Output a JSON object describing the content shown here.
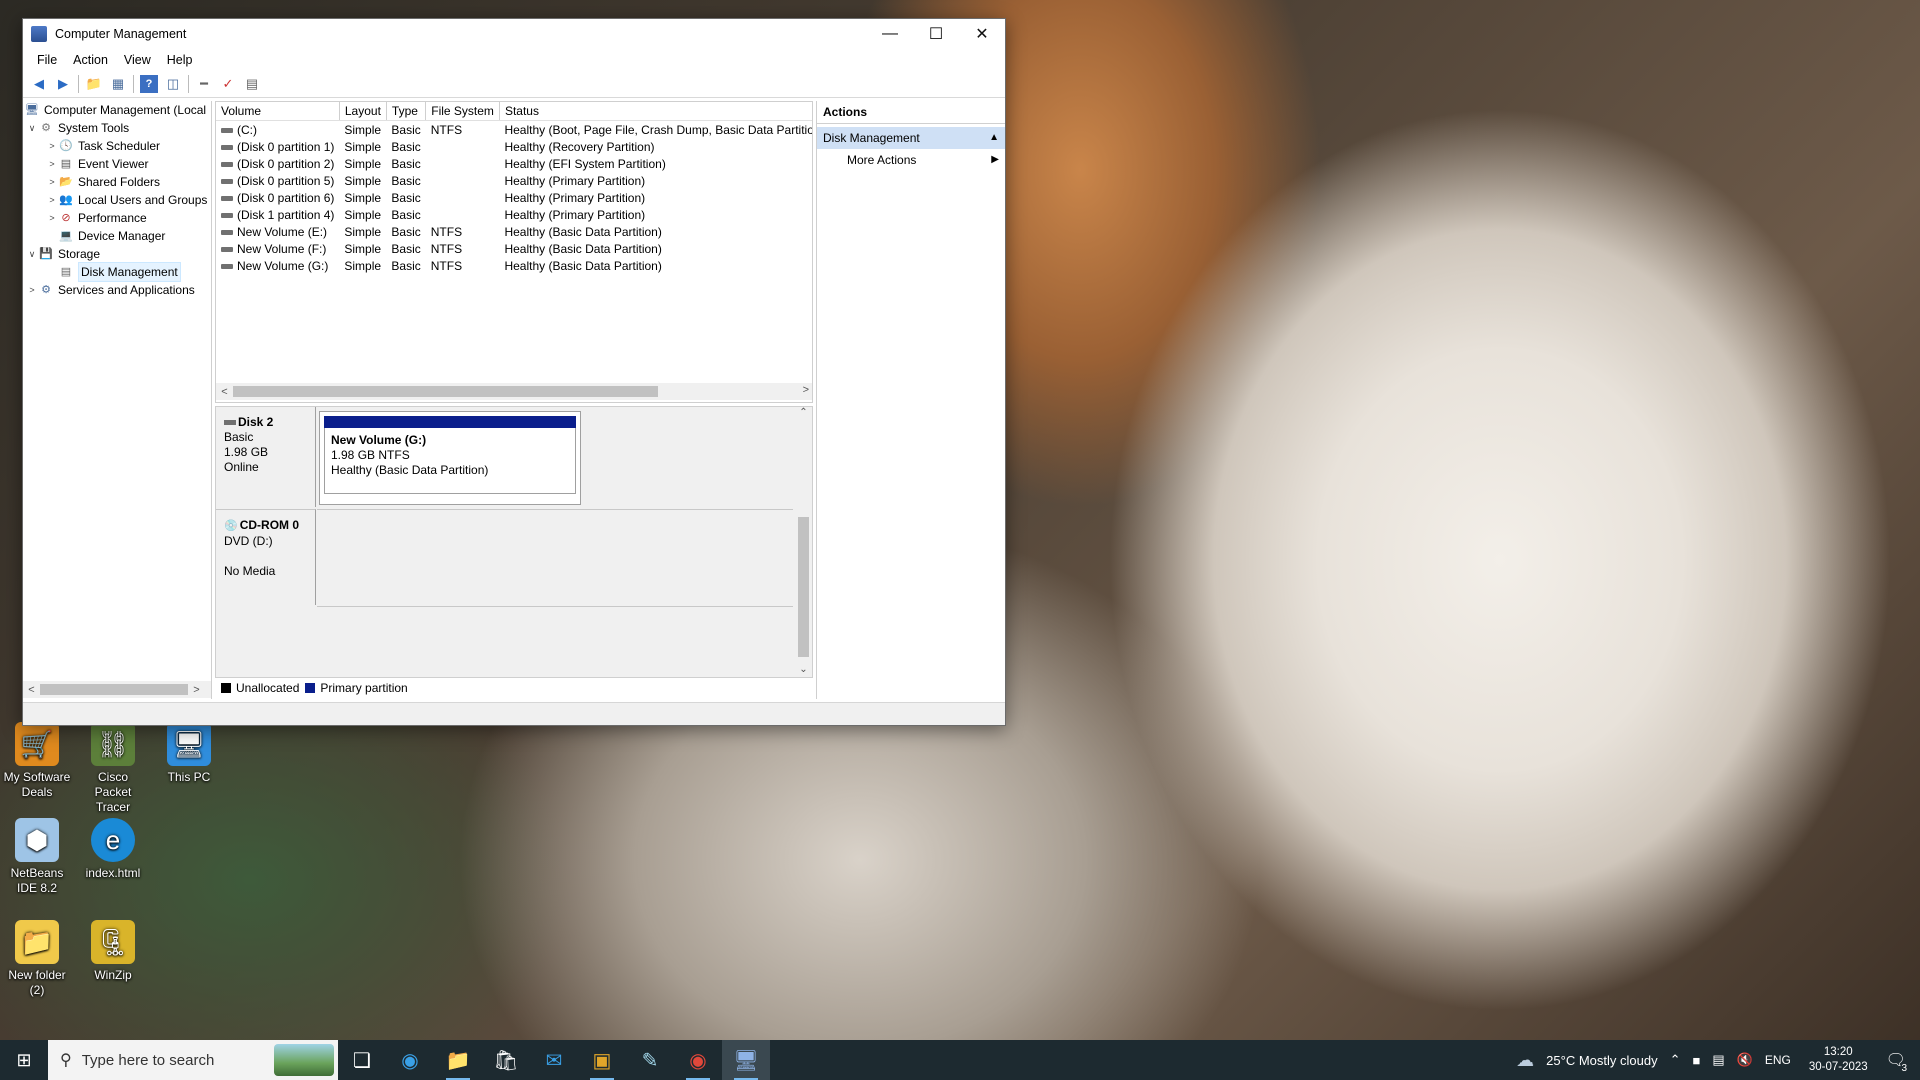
{
  "desktop": {
    "icons": [
      {
        "label": "My Software Deals",
        "icon": "shopping-cart-icon"
      },
      {
        "label": "Cisco Packet Tracer",
        "icon": "network-icon"
      },
      {
        "label": "This PC",
        "icon": "computer-icon"
      },
      {
        "label": "NetBeans IDE 8.2",
        "icon": "netbeans-icon"
      },
      {
        "label": "index.html",
        "icon": "edge-icon"
      },
      {
        "label": "New folder (2)",
        "icon": "folder-icon"
      },
      {
        "label": "WinZip",
        "icon": "winzip-icon"
      }
    ]
  },
  "window": {
    "title": "Computer Management",
    "menu": [
      "File",
      "Action",
      "View",
      "Help"
    ],
    "tree": {
      "root": "Computer Management (Local",
      "items": [
        {
          "label": "System Tools"
        },
        {
          "label": "Task Scheduler"
        },
        {
          "label": "Event Viewer"
        },
        {
          "label": "Shared Folders"
        },
        {
          "label": "Local Users and Groups"
        },
        {
          "label": "Performance"
        },
        {
          "label": "Device Manager"
        },
        {
          "label": "Storage"
        },
        {
          "label": "Disk Management"
        },
        {
          "label": "Services and Applications"
        }
      ]
    },
    "volume_table": {
      "headers": [
        "Volume",
        "Layout",
        "Type",
        "File System",
        "Status"
      ],
      "rows": [
        {
          "volume": "(C:)",
          "layout": "Simple",
          "type": "Basic",
          "fs": "NTFS",
          "status": "Healthy (Boot, Page File, Crash Dump, Basic Data Partition)"
        },
        {
          "volume": "(Disk 0 partition 1)",
          "layout": "Simple",
          "type": "Basic",
          "fs": "",
          "status": "Healthy (Recovery Partition)"
        },
        {
          "volume": "(Disk 0 partition 2)",
          "layout": "Simple",
          "type": "Basic",
          "fs": "",
          "status": "Healthy (EFI System Partition)"
        },
        {
          "volume": "(Disk 0 partition 5)",
          "layout": "Simple",
          "type": "Basic",
          "fs": "",
          "status": "Healthy (Primary Partition)"
        },
        {
          "volume": "(Disk 0 partition 6)",
          "layout": "Simple",
          "type": "Basic",
          "fs": "",
          "status": "Healthy (Primary Partition)"
        },
        {
          "volume": "(Disk 1 partition 4)",
          "layout": "Simple",
          "type": "Basic",
          "fs": "",
          "status": "Healthy (Primary Partition)"
        },
        {
          "volume": "New Volume (E:)",
          "layout": "Simple",
          "type": "Basic",
          "fs": "NTFS",
          "status": "Healthy (Basic Data Partition)"
        },
        {
          "volume": "New Volume (F:)",
          "layout": "Simple",
          "type": "Basic",
          "fs": "NTFS",
          "status": "Healthy (Basic Data Partition)"
        },
        {
          "volume": "New Volume (G:)",
          "layout": "Simple",
          "type": "Basic",
          "fs": "NTFS",
          "status": "Healthy (Basic Data Partition)"
        }
      ]
    },
    "disks": [
      {
        "name": "Disk 2",
        "type": "Basic",
        "size": "1.98 GB",
        "state": "Online",
        "volume": {
          "name": "New Volume  (G:)",
          "size": "1.98 GB NTFS",
          "status": "Healthy (Basic Data Partition)"
        }
      },
      {
        "name": "CD-ROM 0",
        "type": "DVD (D:)",
        "state": "No Media"
      }
    ],
    "legend": [
      {
        "label": "Unallocated",
        "color": "#000000"
      },
      {
        "label": "Primary partition",
        "color": "#0a1e8c"
      }
    ],
    "actions": {
      "header": "Actions",
      "section": "Disk Management",
      "items": [
        "More Actions"
      ]
    }
  },
  "taskbar": {
    "search_placeholder": "Type here to search",
    "weather": "25°C  Mostly cloudy",
    "language": "ENG",
    "time": "13:20",
    "date": "30-07-2023",
    "notification_count": "3"
  }
}
